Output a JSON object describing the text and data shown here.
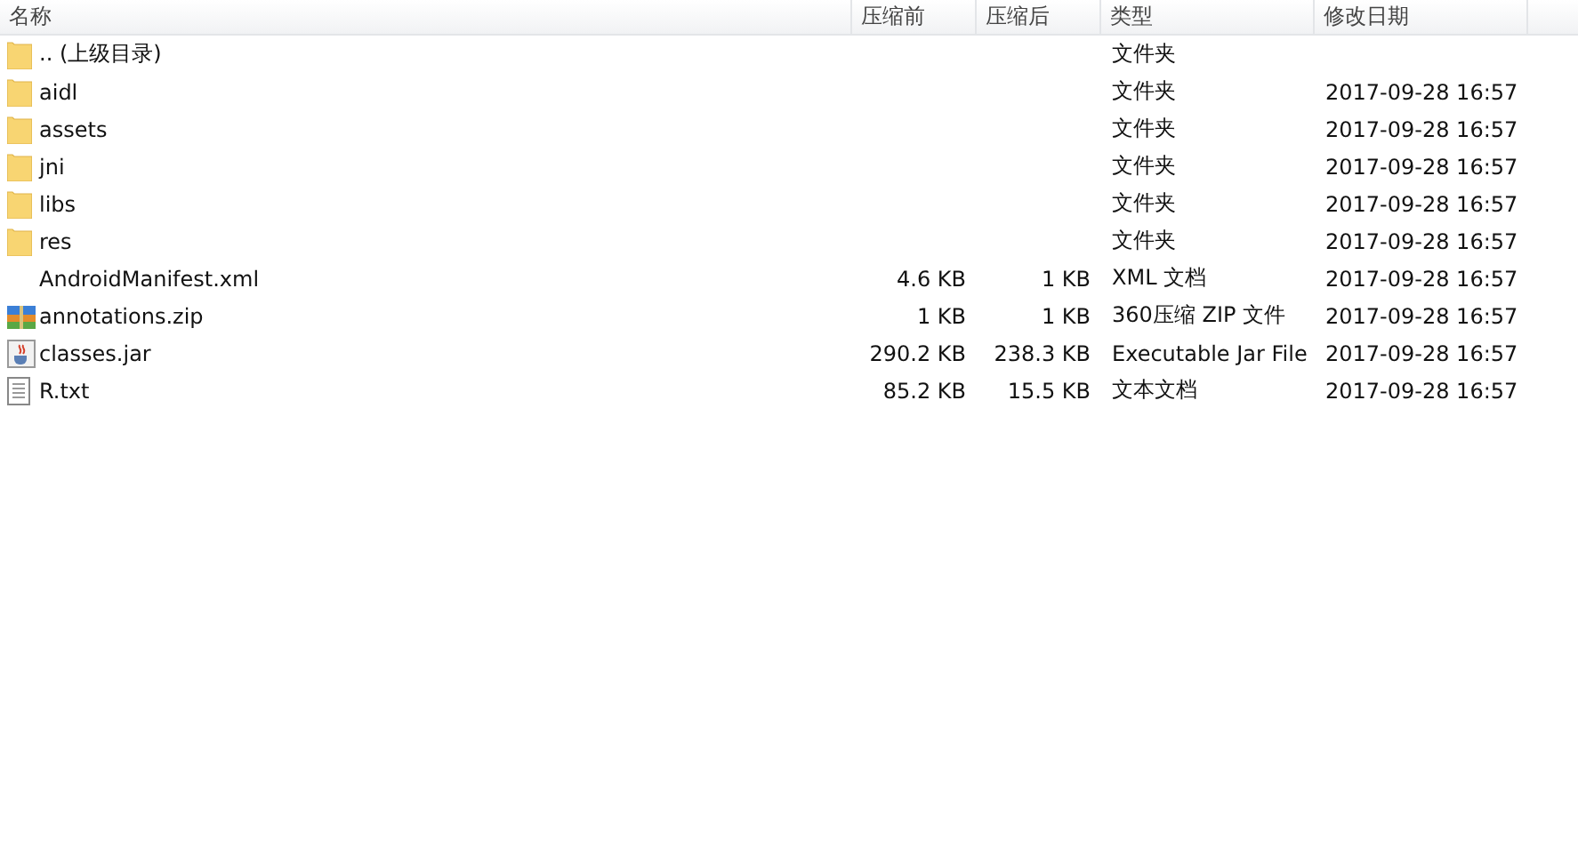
{
  "table": {
    "columns": [
      "名称",
      "压缩前",
      "压缩后",
      "类型",
      "修改日期"
    ],
    "rows": [
      {
        "kind": "folder",
        "name": ".. (上级目录)",
        "size": "",
        "packed": "",
        "type": "文件夹",
        "modified": ""
      },
      {
        "kind": "folder",
        "name": "aidl",
        "size": "",
        "packed": "",
        "type": "文件夹",
        "modified": "2017-09-28 16:57"
      },
      {
        "kind": "folder",
        "name": "assets",
        "size": "",
        "packed": "",
        "type": "文件夹",
        "modified": "2017-09-28 16:57"
      },
      {
        "kind": "folder",
        "name": "jni",
        "size": "",
        "packed": "",
        "type": "文件夹",
        "modified": "2017-09-28 16:57"
      },
      {
        "kind": "folder",
        "name": "libs",
        "size": "",
        "packed": "",
        "type": "文件夹",
        "modified": "2017-09-28 16:57"
      },
      {
        "kind": "folder",
        "name": "res",
        "size": "",
        "packed": "",
        "type": "文件夹",
        "modified": "2017-09-28 16:57"
      },
      {
        "kind": "blank",
        "name": "AndroidManifest.xml",
        "size": "4.6 KB",
        "packed": "1 KB",
        "type": "XML 文档",
        "modified": "2017-09-28 16:57"
      },
      {
        "kind": "archive",
        "name": "annotations.zip",
        "size": "1 KB",
        "packed": "1 KB",
        "type": "360压缩 ZIP 文件",
        "modified": "2017-09-28 16:57"
      },
      {
        "kind": "jar",
        "name": "classes.jar",
        "size": "290.2 KB",
        "packed": "238.3 KB",
        "type": "Executable Jar File",
        "modified": "2017-09-28 16:57"
      },
      {
        "kind": "text",
        "name": "R.txt",
        "size": "85.2 KB",
        "packed": "15.5 KB",
        "type": "文本文档",
        "modified": "2017-09-28 16:57"
      }
    ]
  }
}
